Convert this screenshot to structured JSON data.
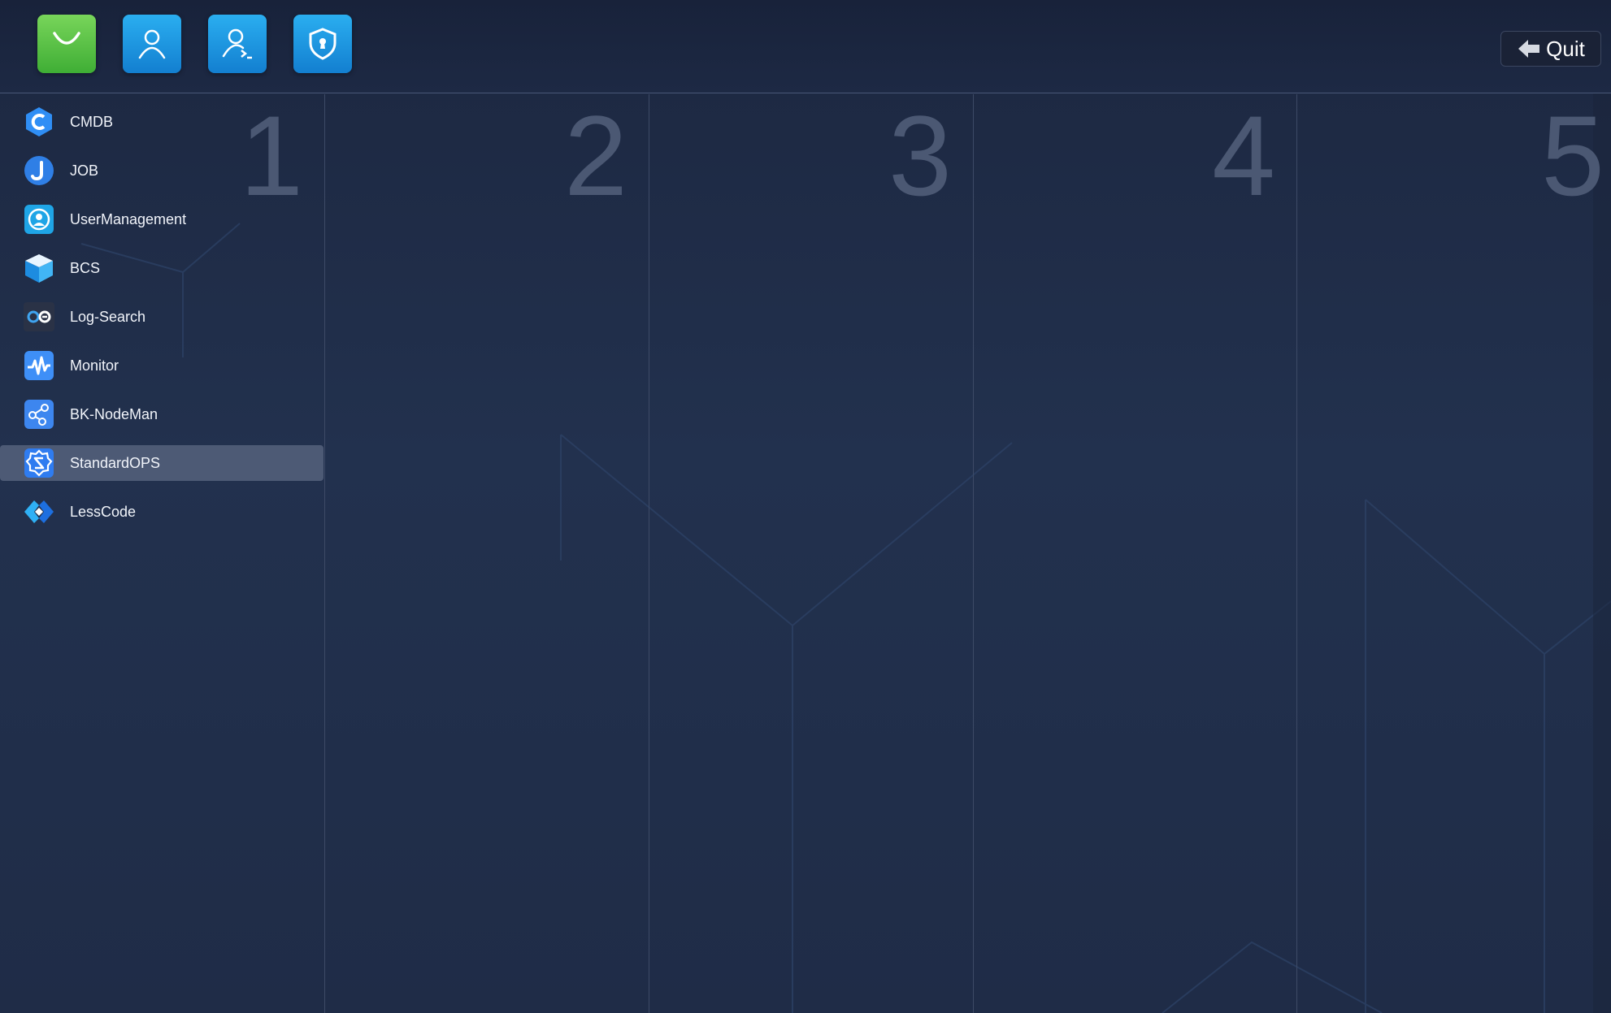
{
  "topbar": {
    "dock": [
      {
        "name": "app-store",
        "icon": "shopping-bag-icon",
        "color": "#5cc443"
      },
      {
        "name": "user-profile",
        "icon": "user-icon",
        "color": "#1e9ae0"
      },
      {
        "name": "user-terminal",
        "icon": "user-console-icon",
        "color": "#1e9ae0"
      },
      {
        "name": "security",
        "icon": "shield-icon",
        "color": "#1e9ae0"
      }
    ],
    "quit_label": "Quit"
  },
  "columns": [
    "1",
    "2",
    "3",
    "4",
    "5"
  ],
  "apps": [
    {
      "label": "CMDB",
      "icon": "cmdb-icon"
    },
    {
      "label": "JOB",
      "icon": "job-icon"
    },
    {
      "label": "UserManagement",
      "icon": "user-management-icon"
    },
    {
      "label": "BCS",
      "icon": "bcs-cube-icon"
    },
    {
      "label": "Log-Search",
      "icon": "log-search-icon"
    },
    {
      "label": "Monitor",
      "icon": "monitor-pulse-icon"
    },
    {
      "label": "BK-NodeMan",
      "icon": "nodeman-icon"
    },
    {
      "label": "StandardOPS",
      "icon": "standardops-icon",
      "selected": true
    },
    {
      "label": "LessCode",
      "icon": "lesscode-icon"
    }
  ],
  "colors": {
    "selected_row": "#4d5a75",
    "column_number": "#4b5873",
    "divider": "#3d4a66"
  }
}
